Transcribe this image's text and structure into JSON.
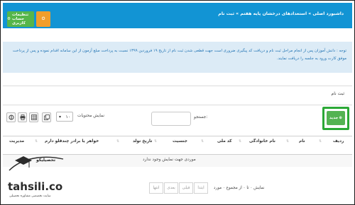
{
  "header": {
    "title": "داشبورد اصلی » استعدادهای درخشان پایه هفتم » ثبت نام",
    "buttons": [
      {
        "label": "تنظیمات حساب کاربری",
        "color": "#55b64a",
        "icon": "gear-icon"
      },
      {
        "label": "خروج",
        "color": "#f19e2b",
        "icon": "power-icon"
      }
    ]
  },
  "notice": {
    "text": "توجه : دانش آموزان پس از انجام مراحل ثبت نام و دریافت کد پیگیری ضروری است جهت قطعی شدن ثبت نام از تاریخ ۱۹ فروردین ۱۳۹۹ نسبت به پرداخت مبلغ آزمون از این سامانه اقدام نموده و پس از پرداخت موفق کارت ورود به جلسه را دریافت نمایند."
  },
  "section": {
    "label": "ثبت نام"
  },
  "toolbar": {
    "new_label": "جدید",
    "search_label": "جستجو:",
    "search_value": "",
    "show_label": "نمایش محتویات",
    "page_size": "۱۰",
    "icons": [
      "copy-icon",
      "table-icon",
      "print-icon",
      "pdf-icon"
    ]
  },
  "table": {
    "columns": [
      "ردیف",
      "نام",
      "نام خانوادگی",
      "کد ملی",
      "جنسیت",
      "تاریخ تولد",
      "خواهر یا برادر چندقلو دارم",
      "مدیریت"
    ],
    "empty_text": "موردی جهت نمایش وجود ندارد",
    "info": "نمایش ۰ تا ۰ از مجموع ۰ مورد"
  },
  "pagination": {
    "first": "ابتدا",
    "prev": "قبلی",
    "next": "بعدی",
    "last": "انتها"
  },
  "watermark": {
    "fa_name": "تحصیلیکو",
    "domain": "tahsili.co",
    "tagline": "سایت تخصصی مشاوره تحصیلی"
  }
}
